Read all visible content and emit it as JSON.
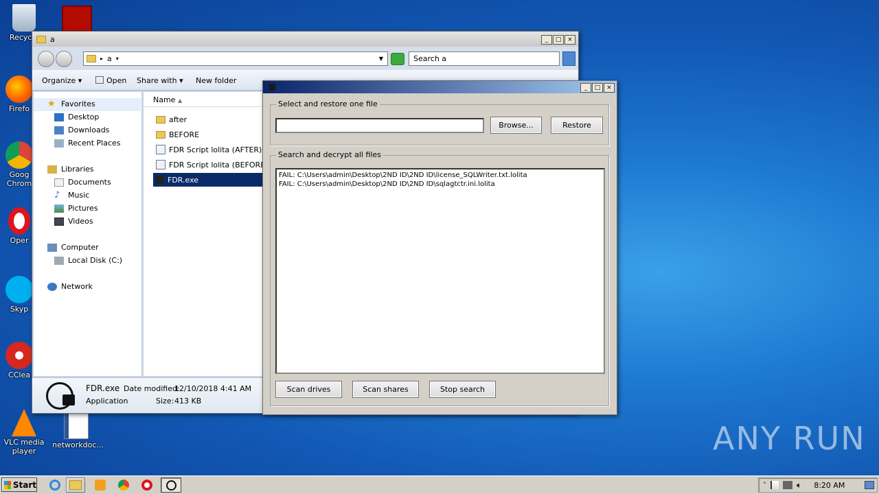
{
  "desktop": {
    "icons": [
      {
        "label": "Recycle",
        "icon": "recycle-bin-icon"
      },
      {
        "label": "Firefo",
        "icon": "firefox-icon"
      },
      {
        "label": "Goog Chrom",
        "icon": "chrome-icon"
      },
      {
        "label": "Oper",
        "icon": "opera-icon"
      },
      {
        "label": "Skyp",
        "icon": "skype-icon"
      },
      {
        "label": "CClea",
        "icon": "ccleaner-icon"
      },
      {
        "label": "VLC media player",
        "icon": "vlc-icon"
      },
      {
        "label": "networkdoc...",
        "icon": "word-document-icon"
      }
    ],
    "watermark": "ANY RUN"
  },
  "explorer": {
    "title": "a",
    "address_crumb": "a",
    "search_placeholder": "Search a",
    "toolbar": {
      "organize": "Organize",
      "open": "Open",
      "share_with": "Share with",
      "new_folder": "New folder"
    },
    "nav": {
      "favorites": "Favorites",
      "desktop": "Desktop",
      "downloads": "Downloads",
      "recent": "Recent Places",
      "libraries": "Libraries",
      "documents": "Documents",
      "music": "Music",
      "pictures": "Pictures",
      "videos": "Videos",
      "computer": "Computer",
      "local_disk": "Local Disk (C:)",
      "network": "Network"
    },
    "column_name": "Name",
    "files": [
      {
        "name": "after"
      },
      {
        "name": "BEFORE"
      },
      {
        "name": "FDR Script lolita (AFTER) - Co"
      },
      {
        "name": "FDR Script lolita (BEFORE) - C"
      },
      {
        "name": "FDR.exe"
      }
    ],
    "details": {
      "name": "FDR.exe",
      "type": "Application",
      "modified_label": "Date modified:",
      "modified_value": "12/10/2018 4:41 AM",
      "size_label": "Size:",
      "size_value": "413 KB"
    }
  },
  "dialog": {
    "group1_title": "Select and restore one file",
    "file_value": "",
    "browse": "Browse...",
    "restore": "Restore",
    "group2_title": "Search and decrypt all files",
    "log": [
      "FAIL: C:\\Users\\admin\\Desktop\\2ND ID\\2ND ID\\license_SQLWriter.txt.lolita",
      "FAIL: C:\\Users\\admin\\Desktop\\2ND ID\\2ND ID\\sqlagtctr.ini.lolita"
    ],
    "scan_drives": "Scan drives",
    "scan_shares": "Scan shares",
    "stop_search": "Stop search"
  },
  "taskbar": {
    "start": "Start",
    "clock": "8:20 AM"
  }
}
